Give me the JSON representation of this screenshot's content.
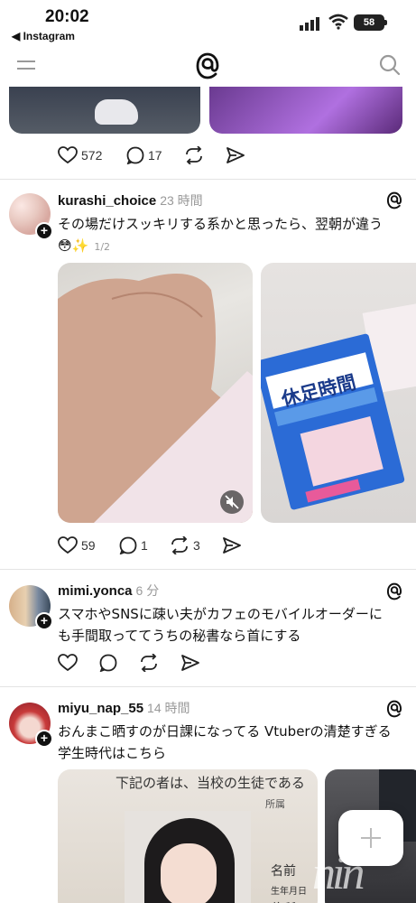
{
  "status_bar": {
    "time": "20:02",
    "back_app": "◀ Instagram",
    "battery": "58"
  },
  "nav": {
    "menu_icon": "menu-icon",
    "logo_icon": "threads-logo",
    "search_icon": "search-icon"
  },
  "previous_post": {
    "likes": "572",
    "replies": "17"
  },
  "posts": [
    {
      "username": "kurashi_choice",
      "time": "23 時間",
      "text": "その場だけスッキリする系かと思ったら、翌朝が違う",
      "emoji": "😳✨",
      "pager": "1/2",
      "package_text": "休足時間",
      "likes": "59",
      "replies": "1",
      "reposts": "3"
    },
    {
      "username": "mimi.yonca",
      "time": "6 分",
      "text_line1": "スマホやSNSに疎い夫がカフェのモバイルオーダーに",
      "text_line2": "も手間取っててうちの秘書なら首にする"
    },
    {
      "username": "miyu_nap_55",
      "time": "14 時間",
      "text_line1": "おんまこ晒すのが日課になってる Vtuberの清楚すぎる",
      "text_line2": "学生時代はこちら",
      "doc_line1": "下記の者は、当校の生徒である",
      "doc_line2": "所属",
      "doc_name": "名前",
      "doc_birth": "生年月日",
      "doc_address": "住所"
    }
  ],
  "compose": {
    "icon": "plus-icon"
  },
  "watermark": "nin"
}
